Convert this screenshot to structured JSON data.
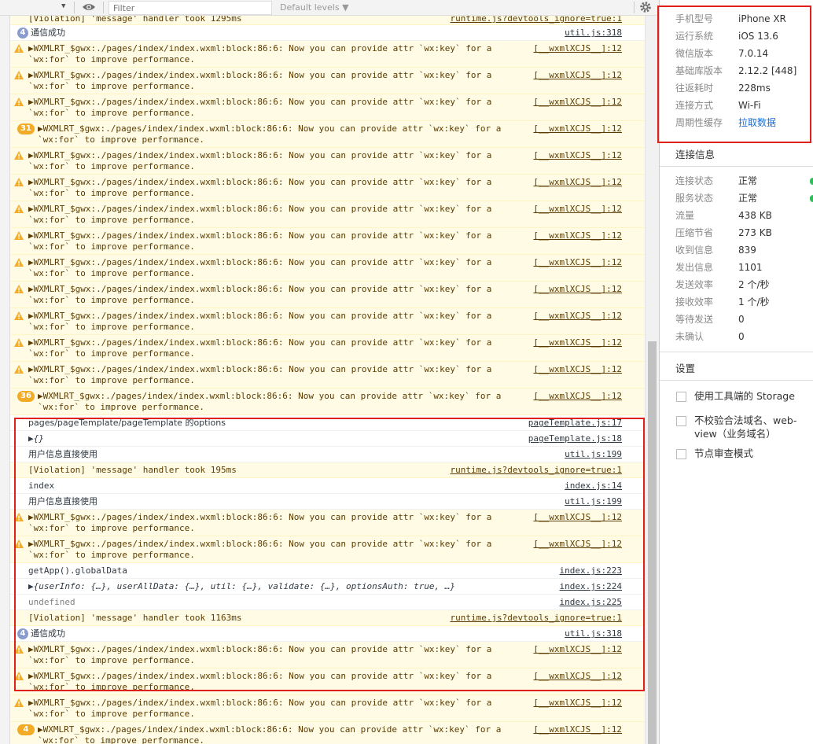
{
  "toolbar": {
    "dropdown_arrow": "▼",
    "filter_placeholder": "Filter",
    "levels_label": "Default levels ▼"
  },
  "console": {
    "top_partial": {
      "msg": "[Violation] 'message' handler took 1295ms",
      "src": "runtime.js?devtools_ignore=true:1"
    },
    "rows": [
      {
        "kind": "info-badge",
        "count": "4",
        "msg": "通信成功",
        "src": "util.js:318"
      },
      {
        "kind": "warn",
        "msg": "▶WXMLRT_$gwx:./pages/index/index.wxml:block:86:6: Now you can provide attr `wx:key` for a",
        "msg2": "`wx:for` to improve performance.",
        "src": "[__wxmlXCJS__]:12"
      },
      {
        "kind": "warn",
        "msg": "▶WXMLRT_$gwx:./pages/index/index.wxml:block:86:6: Now you can provide attr `wx:key` for a",
        "msg2": "`wx:for` to improve performance.",
        "src": "[__wxmlXCJS__]:12"
      },
      {
        "kind": "warn",
        "msg": "▶WXMLRT_$gwx:./pages/index/index.wxml:block:86:6: Now you can provide attr `wx:key` for a",
        "msg2": "`wx:for` to improve performance.",
        "src": "[__wxmlXCJS__]:12"
      },
      {
        "kind": "warn-badge",
        "count": "31",
        "msg": "▶WXMLRT_$gwx:./pages/index/index.wxml:block:86:6: Now you can provide attr `wx:key` for a",
        "msg2": "`wx:for` to improve performance.",
        "src": "[__wxmlXCJS__]:12"
      },
      {
        "kind": "warn",
        "msg": "▶WXMLRT_$gwx:./pages/index/index.wxml:block:86:6: Now you can provide attr `wx:key` for a",
        "msg2": "`wx:for` to improve performance.",
        "src": "[__wxmlXCJS__]:12"
      },
      {
        "kind": "warn",
        "msg": "▶WXMLRT_$gwx:./pages/index/index.wxml:block:86:6: Now you can provide attr `wx:key` for a",
        "msg2": "`wx:for` to improve performance.",
        "src": "[__wxmlXCJS__]:12"
      },
      {
        "kind": "warn",
        "msg": "▶WXMLRT_$gwx:./pages/index/index.wxml:block:86:6: Now you can provide attr `wx:key` for a",
        "msg2": "`wx:for` to improve performance.",
        "src": "[__wxmlXCJS__]:12"
      },
      {
        "kind": "warn",
        "msg": "▶WXMLRT_$gwx:./pages/index/index.wxml:block:86:6: Now you can provide attr `wx:key` for a",
        "msg2": "`wx:for` to improve performance.",
        "src": "[__wxmlXCJS__]:12"
      },
      {
        "kind": "warn",
        "msg": "▶WXMLRT_$gwx:./pages/index/index.wxml:block:86:6: Now you can provide attr `wx:key` for a",
        "msg2": "`wx:for` to improve performance.",
        "src": "[__wxmlXCJS__]:12"
      },
      {
        "kind": "warn",
        "msg": "▶WXMLRT_$gwx:./pages/index/index.wxml:block:86:6: Now you can provide attr `wx:key` for a",
        "msg2": "`wx:for` to improve performance.",
        "src": "[__wxmlXCJS__]:12"
      },
      {
        "kind": "warn",
        "msg": "▶WXMLRT_$gwx:./pages/index/index.wxml:block:86:6: Now you can provide attr `wx:key` for a",
        "msg2": "`wx:for` to improve performance.",
        "src": "[__wxmlXCJS__]:12"
      },
      {
        "kind": "warn",
        "msg": "▶WXMLRT_$gwx:./pages/index/index.wxml:block:86:6: Now you can provide attr `wx:key` for a",
        "msg2": "`wx:for` to improve performance.",
        "src": "[__wxmlXCJS__]:12"
      },
      {
        "kind": "warn",
        "msg": "▶WXMLRT_$gwx:./pages/index/index.wxml:block:86:6: Now you can provide attr `wx:key` for a",
        "msg2": "`wx:for` to improve performance.",
        "src": "[__wxmlXCJS__]:12"
      },
      {
        "kind": "warn-badge",
        "count": "36",
        "msg": "▶WXMLRT_$gwx:./pages/index/index.wxml:block:86:6: Now you can provide attr `wx:key` for a",
        "msg2": "`wx:for` to improve performance.",
        "src": "[__wxmlXCJS__]:12"
      },
      {
        "kind": "info",
        "msg": "pages/pageTemplate/pageTemplate 的options",
        "src": "pageTemplate.js:17"
      },
      {
        "kind": "info",
        "msg": "▶{}",
        "src": "pageTemplate.js:18"
      },
      {
        "kind": "info",
        "msg": "用户信息直接使用",
        "src": "util.js:199"
      },
      {
        "kind": "warn-plain",
        "msg": "[Violation] 'message' handler took 195ms",
        "src": "runtime.js?devtools_ignore=true:1"
      },
      {
        "kind": "info",
        "msg": "index",
        "src": "index.js:14"
      },
      {
        "kind": "info",
        "msg": "用户信息直接使用",
        "src": "util.js:199"
      },
      {
        "kind": "warn",
        "msg": "▶WXMLRT_$gwx:./pages/index/index.wxml:block:86:6: Now you can provide attr `wx:key` for a",
        "msg2": "`wx:for` to improve performance.",
        "src": "[__wxmlXCJS__]:12"
      },
      {
        "kind": "warn",
        "msg": "▶WXMLRT_$gwx:./pages/index/index.wxml:block:86:6: Now you can provide attr `wx:key` for a",
        "msg2": "`wx:for` to improve performance.",
        "src": "[__wxmlXCJS__]:12"
      },
      {
        "kind": "info",
        "msg": "getApp().globalData",
        "src": "index.js:223"
      },
      {
        "kind": "info",
        "msg": "▶{userInfo: {…}, userAllData: {…}, util: {…}, validate: {…}, optionsAuth: true, …}",
        "src": "index.js:224"
      },
      {
        "kind": "info-grey",
        "msg": "undefined",
        "src": "index.js:225"
      },
      {
        "kind": "warn-plain",
        "msg": "[Violation] 'message' handler took 1163ms",
        "src": "runtime.js?devtools_ignore=true:1"
      },
      {
        "kind": "info-badge",
        "count": "4",
        "msg": "通信成功",
        "src": "util.js:318"
      },
      {
        "kind": "warn",
        "msg": "▶WXMLRT_$gwx:./pages/index/index.wxml:block:86:6: Now you can provide attr `wx:key` for a",
        "msg2": "`wx:for` to improve performance.",
        "src": "[__wxmlXCJS__]:12"
      },
      {
        "kind": "warn",
        "msg": "▶WXMLRT_$gwx:./pages/index/index.wxml:block:86:6: Now you can provide attr `wx:key` for a",
        "msg2": "`wx:for` to improve performance.",
        "src": "[__wxmlXCJS__]:12"
      },
      {
        "kind": "warn",
        "msg": "▶WXMLRT_$gwx:./pages/index/index.wxml:block:86:6: Now you can provide attr `wx:key` for a",
        "msg2": "`wx:for` to improve performance.",
        "src": "[__wxmlXCJS__]:12"
      },
      {
        "kind": "warn-badge",
        "count": "4",
        "msg": "▶WXMLRT_$gwx:./pages/index/index.wxml:block:86:6: Now you can provide attr `wx:key` for a",
        "msg2": "`wx:for` to improve performance.",
        "src": "[__wxmlXCJS__]:12"
      }
    ]
  },
  "device_info": [
    {
      "k": "手机型号",
      "v": "iPhone XR"
    },
    {
      "k": "运行系统",
      "v": "iOS 13.6"
    },
    {
      "k": "微信版本",
      "v": "7.0.14"
    },
    {
      "k": "基础库版本",
      "v": "2.12.2 [448]"
    },
    {
      "k": "往返耗时",
      "v": "228ms"
    },
    {
      "k": "连接方式",
      "v": "Wi-Fi"
    },
    {
      "k": "周期性缓存",
      "v": "拉取数据"
    }
  ],
  "connection": {
    "title": "连接信息",
    "items": [
      {
        "k": "连接状态",
        "v": "正常"
      },
      {
        "k": "服务状态",
        "v": "正常"
      },
      {
        "k": "流量",
        "v": "438 KB"
      },
      {
        "k": "压缩节省",
        "v": "273 KB"
      },
      {
        "k": "收到信息",
        "v": "839"
      },
      {
        "k": "发出信息",
        "v": "1101"
      },
      {
        "k": "发送效率",
        "v": "2 个/秒"
      },
      {
        "k": "接收效率",
        "v": "1 个/秒"
      },
      {
        "k": "等待发送",
        "v": "0"
      },
      {
        "k": "未确认",
        "v": "0"
      }
    ]
  },
  "settings": {
    "title": "设置",
    "options": [
      {
        "label": "使用工具端的 Storage"
      },
      {
        "label": "不校验合法域名、web-view（业务域名）"
      },
      {
        "label": "节点审查模式"
      }
    ]
  },
  "colors": {
    "warn_bg": "#fffbe5",
    "warn_icon": "#f2ab26",
    "highlight": "#e0201b",
    "link": "#1a6dd6",
    "ok": "#2dbf56"
  }
}
